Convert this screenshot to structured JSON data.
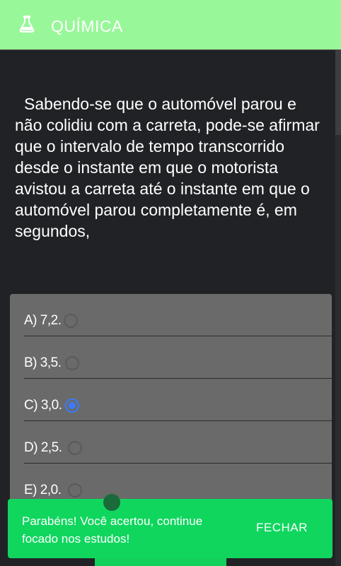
{
  "header": {
    "icon": "flask-icon",
    "title": "QUÍMICA",
    "background_color": "#98f798"
  },
  "question": {
    "text": "Sabendo-se que o automóvel parou e não colidiu com a carreta, pode-se afirmar que o intervalo de tempo transcorrido desde o instante em que o motorista avistou a carreta até o instante em que o automóvel parou completamente é, em segundos,"
  },
  "options": [
    {
      "label": "A) 7,2.",
      "selected": false
    },
    {
      "label": "B) 3,5.",
      "selected": false
    },
    {
      "label": "C) 3,0.",
      "selected": true
    },
    {
      "label": "D) 2,5.",
      "selected": false
    },
    {
      "label": "E) 2,0.",
      "selected": false
    }
  ],
  "snackbar": {
    "message": "Parabéns! Você acertou, continue focado nos estudos!",
    "action_label": "FECHAR",
    "background_color": "#10d65e"
  },
  "colors": {
    "accent_radio": "#3a7bfd",
    "page_background": "#212226",
    "options_background": "#6a6a6a"
  }
}
